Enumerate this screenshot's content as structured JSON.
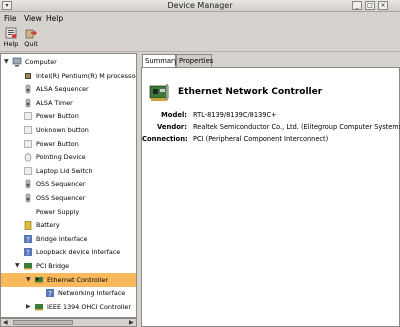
{
  "window": {
    "title": "Device Manager",
    "controls": {
      "minimize": "_",
      "maximize": "□",
      "close": "×"
    }
  },
  "menubar": {
    "file": "File",
    "view": "View",
    "help": "Help"
  },
  "toolbar": {
    "help": "Help",
    "quit": "Quit"
  },
  "tree": {
    "items": [
      {
        "label": "Computer",
        "indent": 0,
        "expander": "▼",
        "icon": "computer-icon"
      },
      {
        "label": "Intel(R) Pentium(R) M processor",
        "indent": 1,
        "expander": "",
        "icon": "chip-icon"
      },
      {
        "label": "ALSA Sequencer",
        "indent": 1,
        "expander": "",
        "icon": "speaker-icon"
      },
      {
        "label": "ALSA Timer",
        "indent": 1,
        "expander": "",
        "icon": "speaker-icon"
      },
      {
        "label": "Power Button",
        "indent": 1,
        "expander": "",
        "icon": "generic-device-icon"
      },
      {
        "label": "Unknown button",
        "indent": 1,
        "expander": "",
        "icon": "generic-device-icon"
      },
      {
        "label": "Power Button",
        "indent": 1,
        "expander": "",
        "icon": "generic-device-icon"
      },
      {
        "label": "Pointing Device",
        "indent": 1,
        "expander": "",
        "icon": "mouse-icon"
      },
      {
        "label": "Laptop Lid Switch",
        "indent": 1,
        "expander": "",
        "icon": "generic-device-icon"
      },
      {
        "label": "OSS Sequencer",
        "indent": 1,
        "expander": "",
        "icon": "speaker-icon"
      },
      {
        "label": "OSS Sequencer",
        "indent": 1,
        "expander": "",
        "icon": "speaker-icon"
      },
      {
        "label": "Power Supply",
        "indent": 1,
        "expander": "",
        "icon": "none"
      },
      {
        "label": "Battery",
        "indent": 1,
        "expander": "",
        "icon": "battery-icon"
      },
      {
        "label": "Bridge Interface",
        "indent": 1,
        "expander": "",
        "icon": "unknown-device-icon"
      },
      {
        "label": "Loopback device Interface",
        "indent": 1,
        "expander": "",
        "icon": "unknown-device-icon"
      },
      {
        "label": "PCI Bridge",
        "indent": 1,
        "expander": "▼",
        "icon": "pci-card-icon"
      },
      {
        "label": "Ethernet Controller",
        "indent": 2,
        "expander": "▼",
        "icon": "network-card-icon",
        "selected": true
      },
      {
        "label": "Networking Interface",
        "indent": 3,
        "expander": "",
        "icon": "unknown-device-icon"
      },
      {
        "label": "IEEE 1394 OHCI Controller",
        "indent": 2,
        "expander": "▶",
        "icon": "pci-card-icon"
      }
    ]
  },
  "tabs": [
    {
      "label": "Summary",
      "active": true
    },
    {
      "label": "Properties",
      "active": false
    }
  ],
  "details": {
    "device_name": "Ethernet Network Controller",
    "rows": [
      {
        "label": "Model:",
        "value": "RTL-8139/8139C/8139C+"
      },
      {
        "label": "Vendor:",
        "value": "Realtek Semiconductor Co., Ltd. (Elitegroup Computer Systems)"
      },
      {
        "label": "Connection:",
        "value": "PCI (Peripheral Component Interconnect)"
      }
    ]
  },
  "colors": {
    "selection": "#f9b95c",
    "window_bg": "#d6d3ce"
  }
}
